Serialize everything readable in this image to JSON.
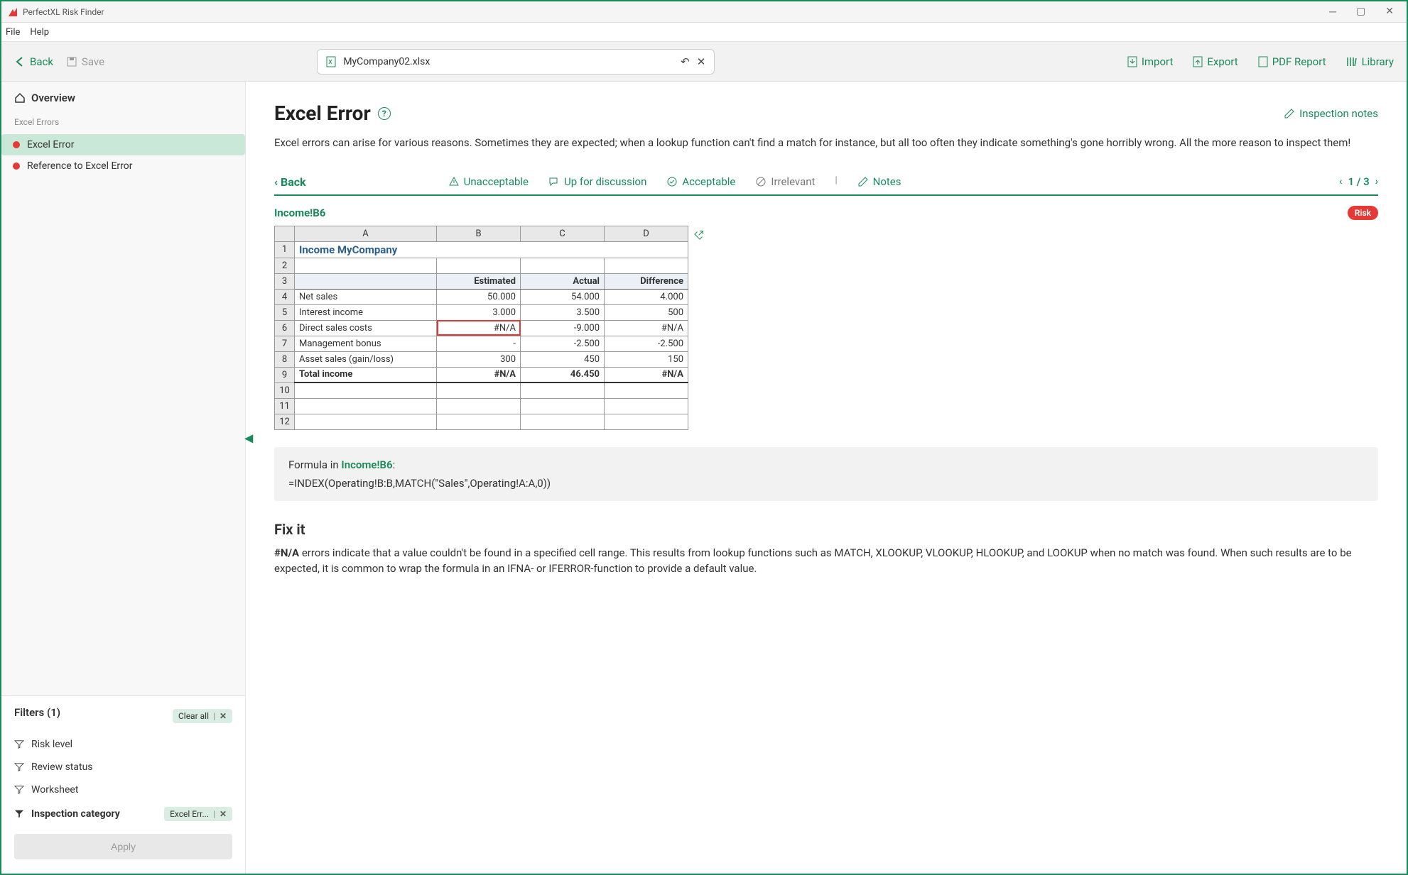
{
  "window": {
    "title": "PerfectXL Risk Finder"
  },
  "menu": {
    "file": "File",
    "help": "Help"
  },
  "toolbar": {
    "back": "Back",
    "save": "Save",
    "filename": "MyCompany02.xlsx",
    "import": "Import",
    "export": "Export",
    "pdf": "PDF Report",
    "library": "Library"
  },
  "sidebar": {
    "overview": "Overview",
    "group_label": "Excel Errors",
    "items": [
      {
        "label": "Excel Error",
        "active": true
      },
      {
        "label": "Reference to Excel Error",
        "active": false
      }
    ]
  },
  "filters": {
    "title": "Filters (1)",
    "clear_all": "Clear all",
    "rows": [
      {
        "label": "Risk level",
        "filled": false
      },
      {
        "label": "Review status",
        "filled": false
      },
      {
        "label": "Worksheet",
        "filled": false
      },
      {
        "label": "Inspection category",
        "filled": true,
        "chip": "Excel Err..."
      }
    ],
    "apply": "Apply"
  },
  "page": {
    "title": "Excel Error",
    "inspection_notes": "Inspection notes",
    "desc": "Excel errors can arise for various reasons. Sometimes they are expected; when a lookup function can't find a match for instance, but all too often they indicate something's gone horribly wrong. All the more reason to inspect them!"
  },
  "actions": {
    "back": "Back",
    "unacceptable": "Unacceptable",
    "discussion": "Up for discussion",
    "acceptable": "Acceptable",
    "irrelevant": "Irrelevant",
    "notes": "Notes",
    "pager_text": "1 / 3"
  },
  "cell": {
    "ref": "Income!B6",
    "risk": "Risk"
  },
  "excel": {
    "columns": [
      "A",
      "B",
      "C",
      "D"
    ],
    "title": "Income MyCompany",
    "headers": [
      "",
      "Estimated",
      "Actual",
      "Difference"
    ],
    "rows": [
      [
        "Net sales",
        "50.000",
        "54.000",
        "4.000"
      ],
      [
        "Interest income",
        "3.000",
        "3.500",
        "500"
      ],
      [
        "Direct sales costs",
        "#N/A",
        "-9.000",
        "#N/A"
      ],
      [
        "Management bonus",
        "-",
        "-2.500",
        "-2.500"
      ],
      [
        "Asset sales (gain/loss)",
        "300",
        "450",
        "150"
      ]
    ],
    "total": [
      "Total income",
      "#N/A",
      "46.450",
      "#N/A"
    ],
    "highlight_row": 2,
    "highlight_col": 1
  },
  "formula": {
    "label": "Formula in ",
    "ref": "Income!B6",
    "text": "=INDEX(Operating!B:B,MATCH(\"Sales\",Operating!A:A,0))"
  },
  "fixit": {
    "title": "Fix it",
    "err": "#N/A",
    "text": " errors indicate that a value couldn't be found in a specified cell range. This results from lookup functions such as MATCH, XLOOKUP, VLOOKUP, HLOOKUP, and LOOKUP when no match was found. When such results are to be expected, it is common to wrap the formula in an IFNA- or IFERROR-function to provide a default value."
  }
}
